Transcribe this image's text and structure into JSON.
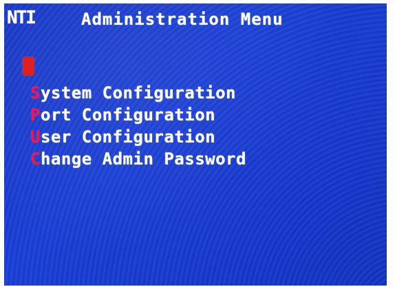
{
  "header": {
    "logo": "NTI",
    "title": "Administration Menu"
  },
  "menu": {
    "items": [
      {
        "hotkey": "S",
        "rest": "ystem Configuration"
      },
      {
        "hotkey": "P",
        "rest": "ort Configuration"
      },
      {
        "hotkey": "U",
        "rest": "ser Configuration"
      },
      {
        "hotkey": "C",
        "rest": "hange Admin Password"
      }
    ]
  },
  "colors": {
    "background": "#1a3fd6",
    "text": "#ffffff",
    "hotkey": "#e8185a",
    "cursor": "#e02020"
  }
}
